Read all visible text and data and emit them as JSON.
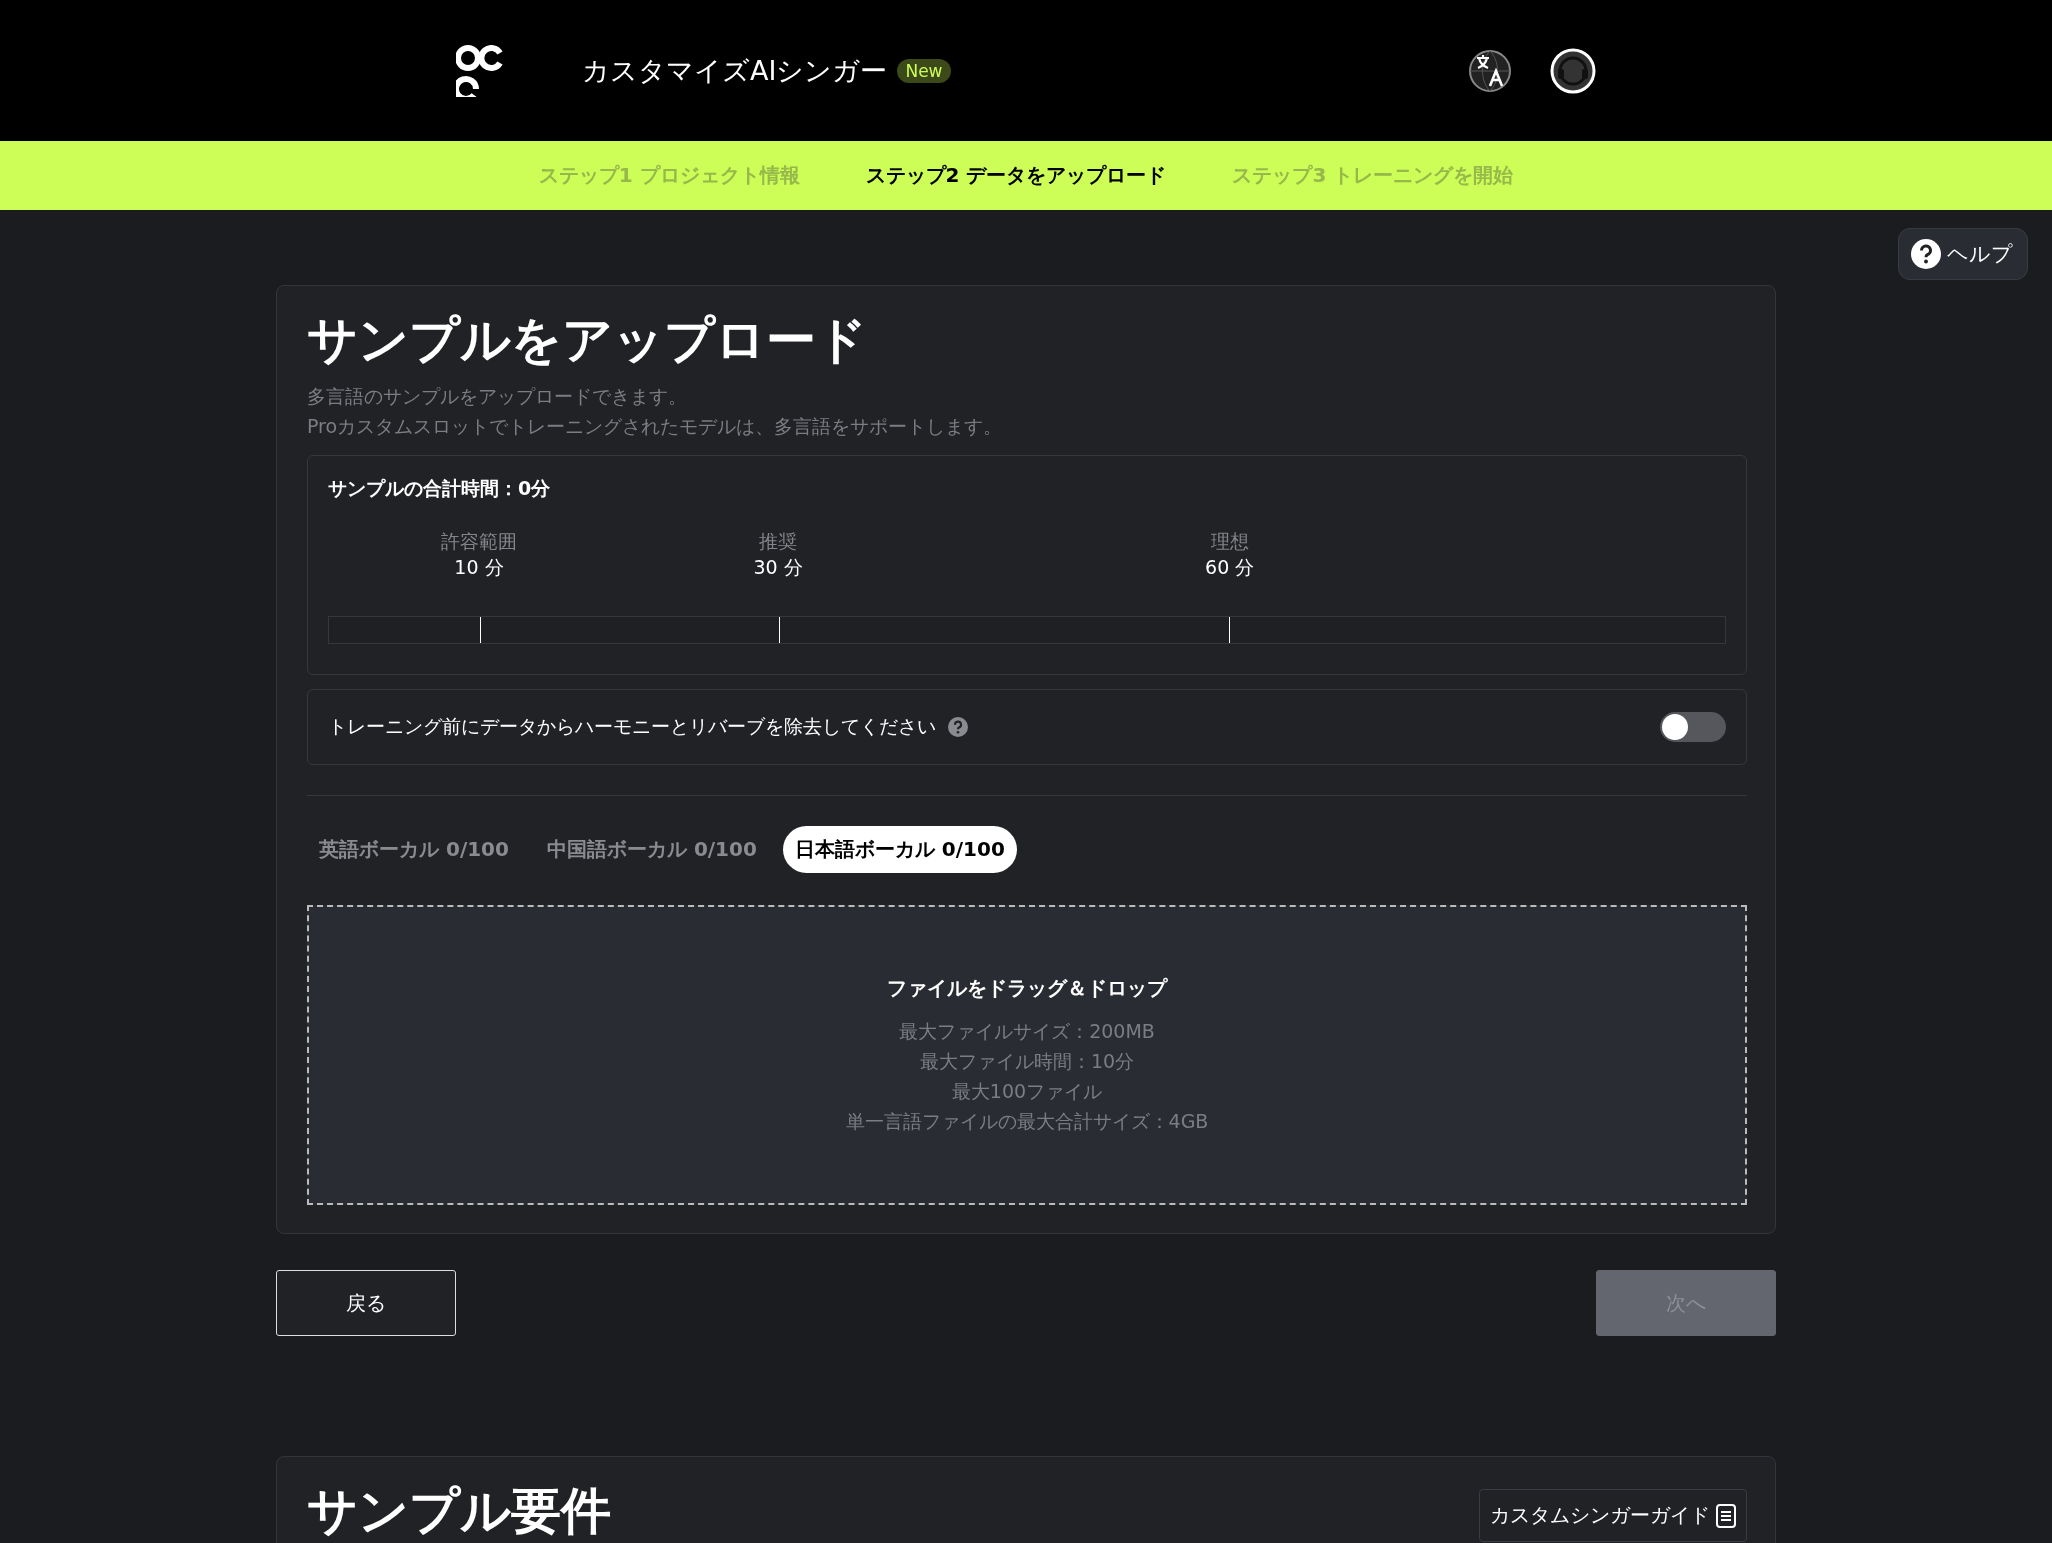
{
  "header": {
    "title": "カスタマイズAIシンガー",
    "badge": "New"
  },
  "steps": [
    {
      "label": "ステップ1 プロジェクト情報",
      "selected": false
    },
    {
      "label": "ステップ2 データをアップロード",
      "selected": true
    },
    {
      "label": "ステップ3 トレーニングを開始",
      "selected": false
    }
  ],
  "help_button": "ヘルプ",
  "upload_card": {
    "title": "サンプルをアップロード",
    "description": [
      "多言語のサンプルをアップロードできます。",
      "Proカスタムスロットでトレーニングされたモデルは、多言語をサポートします。"
    ],
    "total_time": {
      "label": "サンプルの合計時間：0分",
      "milestones": [
        {
          "name": "許容範囲",
          "value": "10 分"
        },
        {
          "name": "推奨",
          "value": "30 分"
        },
        {
          "name": "理想",
          "value": "60 分"
        }
      ]
    },
    "toggle": {
      "label": "トレーニング前にデータからハーモニーとリバーブを除去してください",
      "on": false
    },
    "tabs": [
      {
        "label": "英語ボーカル 0/100",
        "selected": false
      },
      {
        "label": "中国語ボーカル 0/100",
        "selected": false
      },
      {
        "label": "日本語ボーカル 0/100",
        "selected": true
      }
    ],
    "dropzone": {
      "title": "ファイルをドラッグ＆ドロップ",
      "notes": [
        "最大ファイルサイズ：200MB",
        "最大ファイル時間：10分",
        "最大100ファイル",
        "単一言語ファイルの最大合計サイズ：4GB"
      ]
    }
  },
  "buttons": [
    {
      "label": "戻る",
      "disabled": false
    },
    {
      "label": "次へ",
      "disabled": true
    }
  ],
  "requirements_card": {
    "title": "サンプル要件",
    "guide_button": "カスタムシンガーガイド"
  }
}
